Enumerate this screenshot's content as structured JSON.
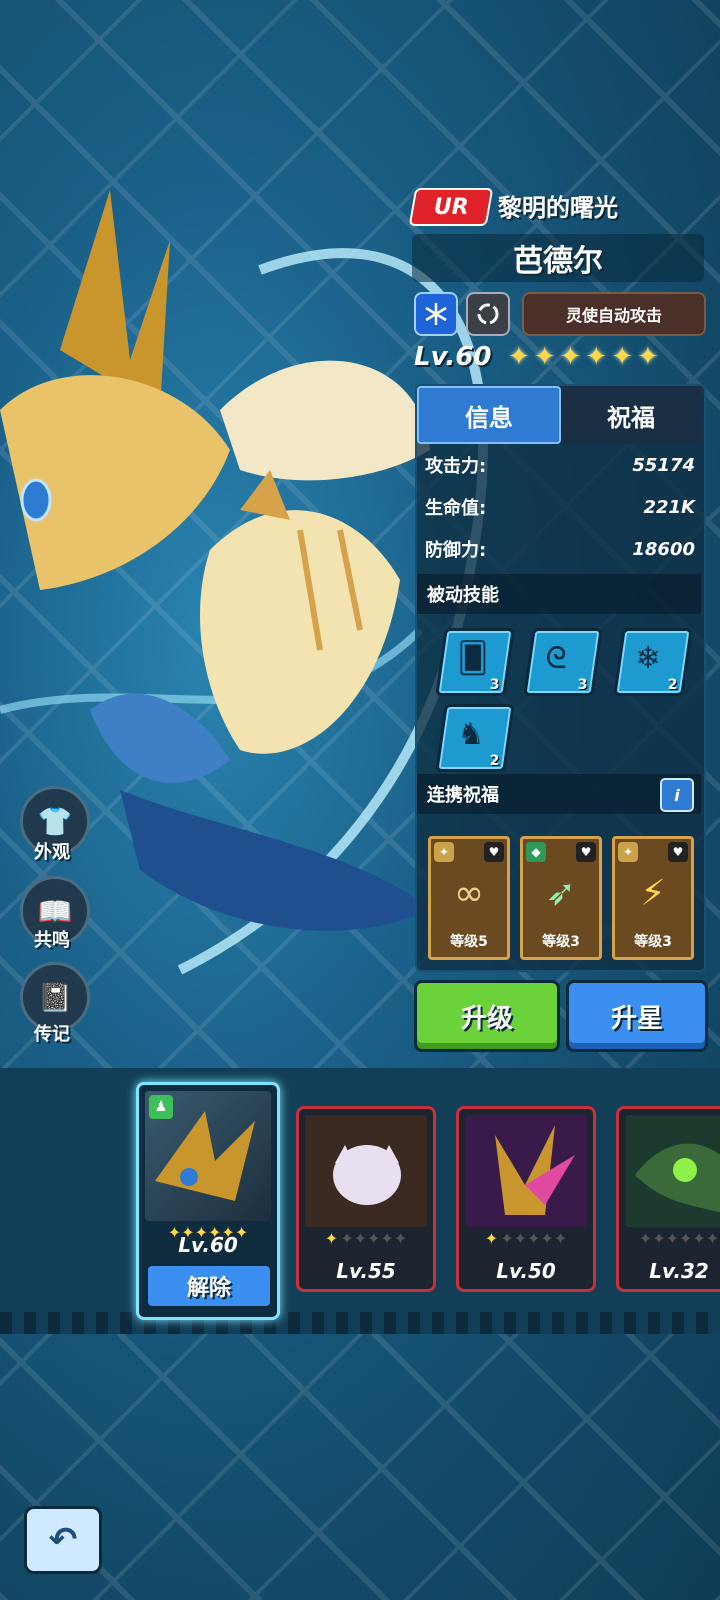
{
  "hero": {
    "rarity": "UR",
    "subtitle": "黎明的曙光",
    "name": "芭德尔",
    "auto_attack_label": "灵使自动攻击",
    "level": "Lv.60",
    "star_count": 6
  },
  "tabs": [
    {
      "label": "信息",
      "active": true
    },
    {
      "label": "祝福",
      "active": false
    }
  ],
  "stats": [
    {
      "label": "攻击力:",
      "value": "55174"
    },
    {
      "label": "生命值:",
      "value": "221K"
    },
    {
      "label": "防御力:",
      "value": "18600"
    }
  ],
  "passive_skills": {
    "title": "被动技能",
    "items": [
      {
        "icon": "cards-icon",
        "level": "3"
      },
      {
        "icon": "spiral-icon",
        "level": "3"
      },
      {
        "icon": "snowflake-icon",
        "level": "2"
      },
      {
        "icon": "silhouette-icon",
        "level": "2"
      }
    ]
  },
  "linked_blessings": {
    "title": "连携祝福",
    "info_label": "i",
    "items": [
      {
        "icon": "beads-icon",
        "level": "等级5"
      },
      {
        "icon": "bird-icon",
        "level": "等级3"
      },
      {
        "icon": "thunder-creature-icon",
        "level": "等级3"
      }
    ]
  },
  "actions": {
    "upgrade_label": "升级",
    "star_up_label": "升星"
  },
  "side_menu": [
    {
      "icon": "shirt-icon",
      "label": "外观"
    },
    {
      "icon": "book-icon",
      "label": "共鸣"
    },
    {
      "icon": "journal-icon",
      "label": "传记"
    }
  ],
  "roster": [
    {
      "level": "Lv.60",
      "filled_stars": 6,
      "selected": true
    },
    {
      "level": "Lv.55",
      "filled_stars": 1,
      "selected": false
    },
    {
      "level": "Lv.50",
      "filled_stars": 1,
      "selected": false
    },
    {
      "level": "Lv.32",
      "filled_stars": 0,
      "selected": false
    }
  ],
  "release_label": "解除",
  "colors": {
    "ur_red": "#e0222a",
    "upgrade_green": "#6cd23a",
    "star_blue": "#3b8ff0",
    "star_gold": "#ffd84a"
  }
}
